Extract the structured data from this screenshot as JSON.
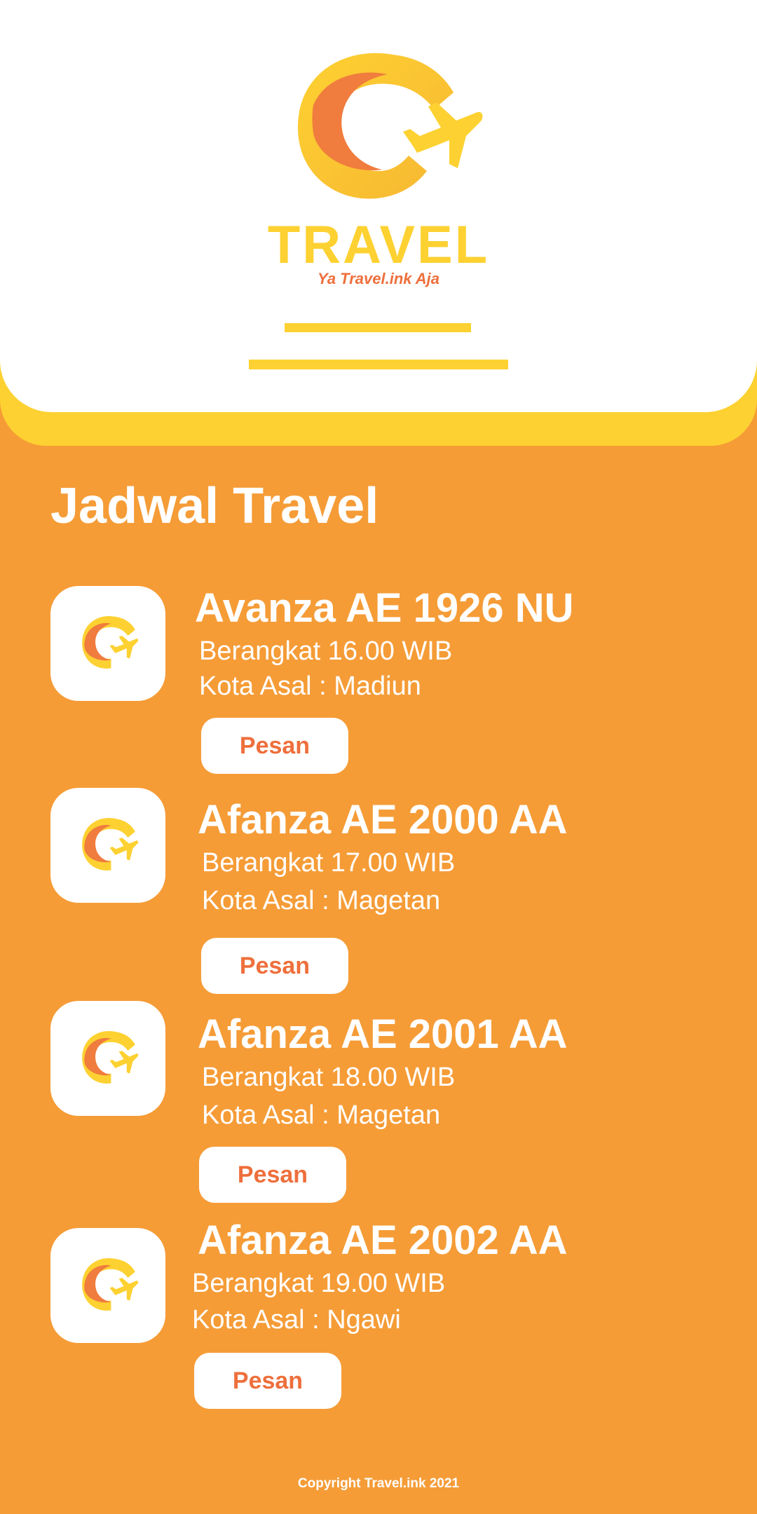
{
  "brand": {
    "name": "TRAVEL",
    "tagline": "Ya Travel.ink Aja"
  },
  "section_title": "Jadwal Travel",
  "schedules": [
    {
      "vehicle": "Avanza AE 1926 NU",
      "departure": "Berangkat 16.00 WIB",
      "origin": "Kota Asal : Madiun",
      "button_label": "Pesan"
    },
    {
      "vehicle": "Afanza AE 2000 AA",
      "departure": "Berangkat 17.00 WIB",
      "origin": "Kota Asal : Magetan",
      "button_label": "Pesan"
    },
    {
      "vehicle": "Afanza AE 2001 AA",
      "departure": "Berangkat 18.00 WIB",
      "origin": "Kota Asal : Magetan",
      "button_label": "Pesan"
    },
    {
      "vehicle": "Afanza AE 2002 AA",
      "departure": "Berangkat 19.00 WIB",
      "origin": "Kota Asal : Ngawi",
      "button_label": "Pesan"
    }
  ],
  "footer": "Copyright Travel.ink 2021",
  "colors": {
    "background": "#f59c37",
    "yellow": "#fdd131",
    "accent": "#ee6f3c",
    "white": "#ffffff"
  },
  "icons": {
    "logo": "g-plane-logo",
    "card_icon": "g-plane-logo"
  }
}
